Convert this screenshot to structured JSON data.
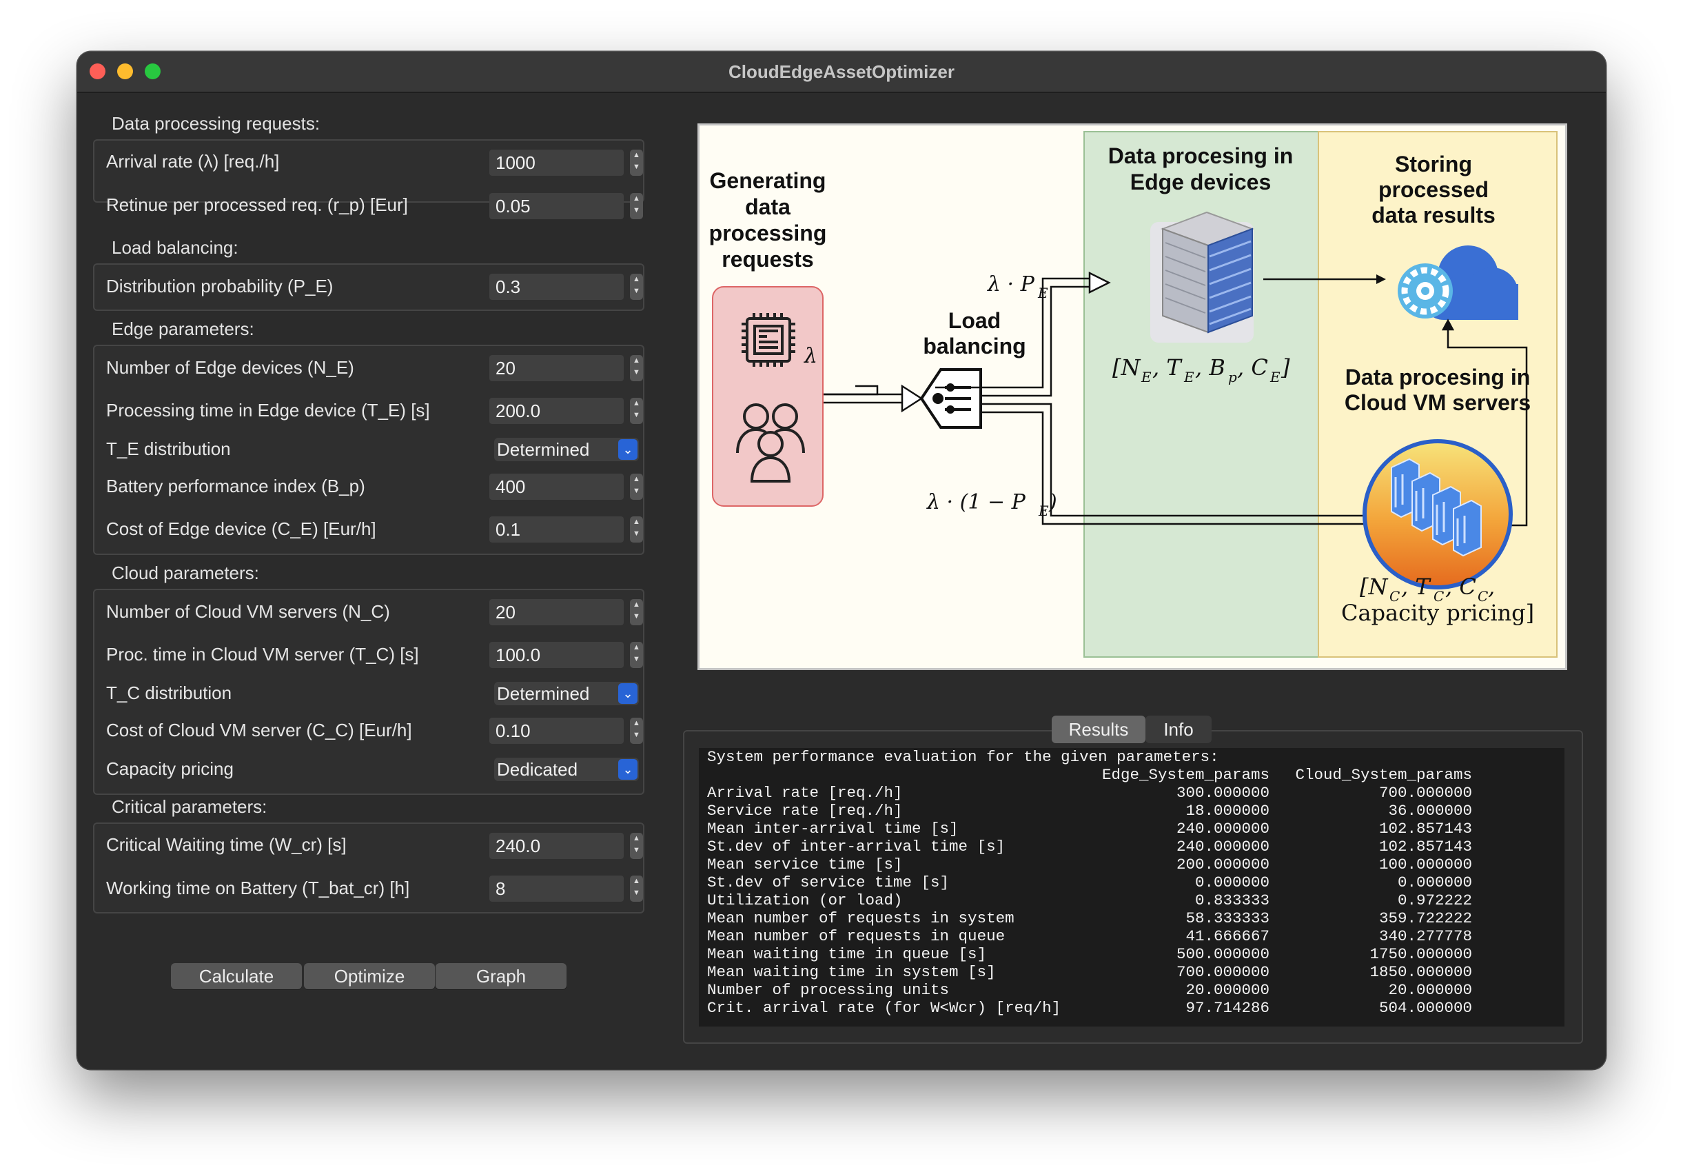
{
  "window": {
    "title": "CloudEdgeAssetOptimizer"
  },
  "sections": {
    "requests": "Data processing requests:",
    "load": "Load balancing:",
    "edge": "Edge parameters:",
    "cloud": "Cloud parameters:",
    "critical": "Critical parameters:"
  },
  "params": {
    "arrival_rate": {
      "label": "Arrival rate (λ) [req./h]",
      "value": "1000"
    },
    "retinue": {
      "label": "Retinue per processed req. (r_p) [Eur]",
      "value": "0.05"
    },
    "distribution_prob": {
      "label": "Distribution probability (P_E)",
      "value": "0.3"
    },
    "n_edge": {
      "label": "Number of Edge devices (N_E)",
      "value": "20"
    },
    "t_edge": {
      "label": "Processing time in Edge device (T_E) [s]",
      "value": "200.0"
    },
    "te_dist": {
      "label": "T_E distribution",
      "value": "Determined"
    },
    "battery": {
      "label": "Battery performance index (B_p)",
      "value": "400"
    },
    "cost_edge": {
      "label": "Cost of Edge device (C_E) [Eur/h]",
      "value": "0.1"
    },
    "n_cloud": {
      "label": "Number of Cloud VM servers (N_C)",
      "value": "20"
    },
    "t_cloud": {
      "label": "Proc. time in Cloud VM server (T_C) [s]",
      "value": "100.0"
    },
    "tc_dist": {
      "label": "T_C distribution",
      "value": "Determined"
    },
    "cost_cloud": {
      "label": "Cost of Cloud VM server (C_C) [Eur/h]",
      "value": "0.10"
    },
    "capacity": {
      "label": "Capacity pricing",
      "value": "Dedicated"
    },
    "w_cr": {
      "label": "Critical Waiting time (W_cr) [s]",
      "value": "240.0"
    },
    "t_bat": {
      "label": "Working time on Battery (T_bat_cr) [h]",
      "value": "8"
    }
  },
  "buttons": {
    "calculate": "Calculate",
    "optimize": "Optimize",
    "graph": "Graph"
  },
  "diagram": {
    "gen_lines": [
      "Generating",
      "data",
      "processing",
      "requests"
    ],
    "edge_title": [
      "Data procesing in",
      "Edge devices"
    ],
    "store_title": [
      "Storing",
      "processed",
      "data results"
    ],
    "cloud_title": [
      "Data procesing in",
      "Cloud VM servers"
    ],
    "lb_lines": [
      "Load",
      "balancing"
    ],
    "lambda": "λ",
    "lambda_pe": "λ · P",
    "lambda_1pe_a": "λ · (1 − P",
    "lambda_1pe_b": ")",
    "sub_e": "E",
    "sub_c": "C",
    "sub_p": "p",
    "edge_vars": [
      "[N",
      ", T",
      ", B",
      ", C",
      "]"
    ],
    "cloud_vars_line1": [
      "[N",
      ", T",
      ", C",
      ","
    ],
    "cloud_vars_line2": "Capacity pricing]",
    "colors": {
      "edge_bg": "#d6e8d3",
      "cloud_bg": "#fdf3c8",
      "gen_box": "#f2c8c8"
    }
  },
  "tabs": {
    "results": "Results",
    "info": "Info"
  },
  "results": {
    "title": "System performance evaluation for the given parameters:",
    "headers": [
      "Edge_System_params",
      "Cloud_System_params"
    ],
    "rows": [
      [
        "Arrival rate [req./h]",
        "300.000000",
        "700.000000"
      ],
      [
        "Service rate [req./h]",
        "18.000000",
        "36.000000"
      ],
      [
        "Mean inter-arrival time [s]",
        "240.000000",
        "102.857143"
      ],
      [
        "St.dev of inter-arrival time [s]",
        "240.000000",
        "102.857143"
      ],
      [
        "Mean service time [s]",
        "200.000000",
        "100.000000"
      ],
      [
        "St.dev of service time [s]",
        "0.000000",
        "0.000000"
      ],
      [
        "Utilization (or load)",
        "0.833333",
        "0.972222"
      ],
      [
        "Mean number of requests in system",
        "58.333333",
        "359.722222"
      ],
      [
        "Mean number of requests in queue",
        "41.666667",
        "340.277778"
      ],
      [
        "Mean waiting time in queue [s]",
        "500.000000",
        "1750.000000"
      ],
      [
        "Mean waiting time in system [s]",
        "700.000000",
        "1850.000000"
      ],
      [
        "Number of processing units",
        "20.000000",
        "20.000000"
      ],
      [
        "Crit. arrival rate (for W<Wcr) [req/h]",
        "97.714286",
        "504.000000"
      ]
    ]
  }
}
